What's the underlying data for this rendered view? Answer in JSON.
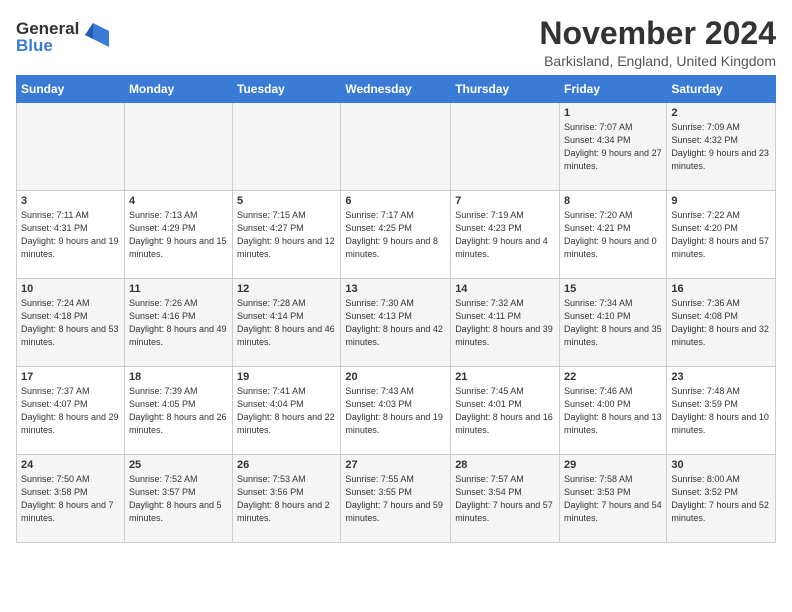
{
  "logo": {
    "line1": "General",
    "line2": "Blue"
  },
  "title": "November 2024",
  "location": "Barkisland, England, United Kingdom",
  "weekdays": [
    "Sunday",
    "Monday",
    "Tuesday",
    "Wednesday",
    "Thursday",
    "Friday",
    "Saturday"
  ],
  "weeks": [
    [
      {
        "day": "",
        "info": ""
      },
      {
        "day": "",
        "info": ""
      },
      {
        "day": "",
        "info": ""
      },
      {
        "day": "",
        "info": ""
      },
      {
        "day": "",
        "info": ""
      },
      {
        "day": "1",
        "info": "Sunrise: 7:07 AM\nSunset: 4:34 PM\nDaylight: 9 hours\nand 27 minutes."
      },
      {
        "day": "2",
        "info": "Sunrise: 7:09 AM\nSunset: 4:32 PM\nDaylight: 9 hours\nand 23 minutes."
      }
    ],
    [
      {
        "day": "3",
        "info": "Sunrise: 7:11 AM\nSunset: 4:31 PM\nDaylight: 9 hours\nand 19 minutes."
      },
      {
        "day": "4",
        "info": "Sunrise: 7:13 AM\nSunset: 4:29 PM\nDaylight: 9 hours\nand 15 minutes."
      },
      {
        "day": "5",
        "info": "Sunrise: 7:15 AM\nSunset: 4:27 PM\nDaylight: 9 hours\nand 12 minutes."
      },
      {
        "day": "6",
        "info": "Sunrise: 7:17 AM\nSunset: 4:25 PM\nDaylight: 9 hours\nand 8 minutes."
      },
      {
        "day": "7",
        "info": "Sunrise: 7:19 AM\nSunset: 4:23 PM\nDaylight: 9 hours\nand 4 minutes."
      },
      {
        "day": "8",
        "info": "Sunrise: 7:20 AM\nSunset: 4:21 PM\nDaylight: 9 hours\nand 0 minutes."
      },
      {
        "day": "9",
        "info": "Sunrise: 7:22 AM\nSunset: 4:20 PM\nDaylight: 8 hours\nand 57 minutes."
      }
    ],
    [
      {
        "day": "10",
        "info": "Sunrise: 7:24 AM\nSunset: 4:18 PM\nDaylight: 8 hours\nand 53 minutes."
      },
      {
        "day": "11",
        "info": "Sunrise: 7:26 AM\nSunset: 4:16 PM\nDaylight: 8 hours\nand 49 minutes."
      },
      {
        "day": "12",
        "info": "Sunrise: 7:28 AM\nSunset: 4:14 PM\nDaylight: 8 hours\nand 46 minutes."
      },
      {
        "day": "13",
        "info": "Sunrise: 7:30 AM\nSunset: 4:13 PM\nDaylight: 8 hours\nand 42 minutes."
      },
      {
        "day": "14",
        "info": "Sunrise: 7:32 AM\nSunset: 4:11 PM\nDaylight: 8 hours\nand 39 minutes."
      },
      {
        "day": "15",
        "info": "Sunrise: 7:34 AM\nSunset: 4:10 PM\nDaylight: 8 hours\nand 35 minutes."
      },
      {
        "day": "16",
        "info": "Sunrise: 7:36 AM\nSunset: 4:08 PM\nDaylight: 8 hours\nand 32 minutes."
      }
    ],
    [
      {
        "day": "17",
        "info": "Sunrise: 7:37 AM\nSunset: 4:07 PM\nDaylight: 8 hours\nand 29 minutes."
      },
      {
        "day": "18",
        "info": "Sunrise: 7:39 AM\nSunset: 4:05 PM\nDaylight: 8 hours\nand 26 minutes."
      },
      {
        "day": "19",
        "info": "Sunrise: 7:41 AM\nSunset: 4:04 PM\nDaylight: 8 hours\nand 22 minutes."
      },
      {
        "day": "20",
        "info": "Sunrise: 7:43 AM\nSunset: 4:03 PM\nDaylight: 8 hours\nand 19 minutes."
      },
      {
        "day": "21",
        "info": "Sunrise: 7:45 AM\nSunset: 4:01 PM\nDaylight: 8 hours\nand 16 minutes."
      },
      {
        "day": "22",
        "info": "Sunrise: 7:46 AM\nSunset: 4:00 PM\nDaylight: 8 hours\nand 13 minutes."
      },
      {
        "day": "23",
        "info": "Sunrise: 7:48 AM\nSunset: 3:59 PM\nDaylight: 8 hours\nand 10 minutes."
      }
    ],
    [
      {
        "day": "24",
        "info": "Sunrise: 7:50 AM\nSunset: 3:58 PM\nDaylight: 8 hours\nand 7 minutes."
      },
      {
        "day": "25",
        "info": "Sunrise: 7:52 AM\nSunset: 3:57 PM\nDaylight: 8 hours\nand 5 minutes."
      },
      {
        "day": "26",
        "info": "Sunrise: 7:53 AM\nSunset: 3:56 PM\nDaylight: 8 hours\nand 2 minutes."
      },
      {
        "day": "27",
        "info": "Sunrise: 7:55 AM\nSunset: 3:55 PM\nDaylight: 7 hours\nand 59 minutes."
      },
      {
        "day": "28",
        "info": "Sunrise: 7:57 AM\nSunset: 3:54 PM\nDaylight: 7 hours\nand 57 minutes."
      },
      {
        "day": "29",
        "info": "Sunrise: 7:58 AM\nSunset: 3:53 PM\nDaylight: 7 hours\nand 54 minutes."
      },
      {
        "day": "30",
        "info": "Sunrise: 8:00 AM\nSunset: 3:52 PM\nDaylight: 7 hours\nand 52 minutes."
      }
    ]
  ]
}
